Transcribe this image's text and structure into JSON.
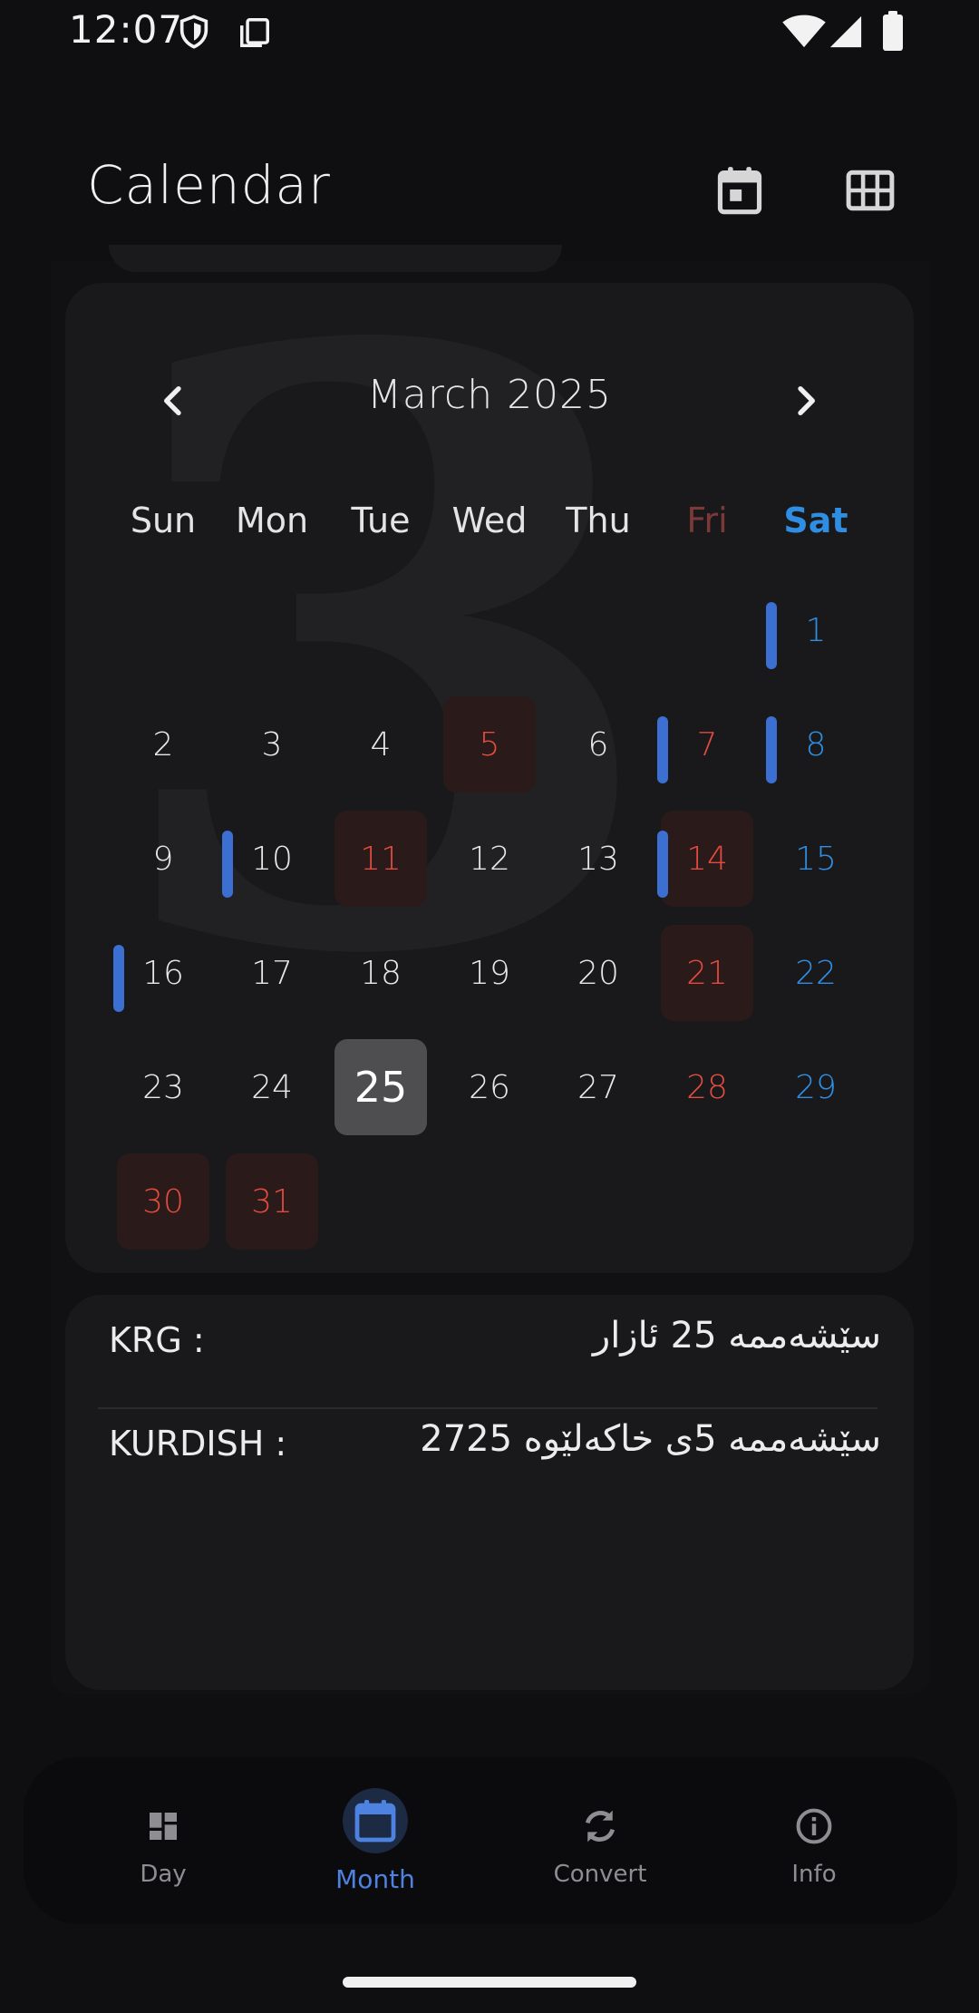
{
  "status_bar": {
    "time": "12:07"
  },
  "app_bar": {
    "title": "Calendar"
  },
  "calendar": {
    "background_numeral": "3",
    "month_title": "March 2025",
    "weekdays": [
      "Sun",
      "Mon",
      "Tue",
      "Wed",
      "Thu",
      "Fri",
      "Sat"
    ],
    "days": [
      {
        "n": "1"
      },
      {
        "n": "2"
      },
      {
        "n": "3"
      },
      {
        "n": "4"
      },
      {
        "n": "5"
      },
      {
        "n": "6"
      },
      {
        "n": "7"
      },
      {
        "n": "8"
      },
      {
        "n": "9"
      },
      {
        "n": "10"
      },
      {
        "n": "11"
      },
      {
        "n": "12"
      },
      {
        "n": "13"
      },
      {
        "n": "14"
      },
      {
        "n": "15"
      },
      {
        "n": "16"
      },
      {
        "n": "17"
      },
      {
        "n": "18"
      },
      {
        "n": "19"
      },
      {
        "n": "20"
      },
      {
        "n": "21"
      },
      {
        "n": "22"
      },
      {
        "n": "23"
      },
      {
        "n": "24"
      },
      {
        "n": "25"
      },
      {
        "n": "26"
      },
      {
        "n": "27"
      },
      {
        "n": "28"
      },
      {
        "n": "29"
      },
      {
        "n": "30"
      },
      {
        "n": "31"
      }
    ]
  },
  "info": {
    "rows": [
      {
        "label": "KRG :",
        "value": "سێشەممە 25 ئازار"
      },
      {
        "label": "KURDISH :",
        "value": "سێشەممە 5ی خاکەلێوە 2725"
      }
    ]
  },
  "bottom_nav": {
    "items": [
      {
        "label": "Day",
        "icon": "dashboard-icon"
      },
      {
        "label": "Month",
        "icon": "calendar-month-icon"
      },
      {
        "label": "Convert",
        "icon": "convert-icon"
      },
      {
        "label": "Info",
        "icon": "info-icon"
      }
    ]
  },
  "colors": {
    "holiday_red": "#e34b3f",
    "weekend_blue": "#2f8ee2",
    "event_marker": "#3b6fd1",
    "active_nav": "#4d82e0"
  }
}
